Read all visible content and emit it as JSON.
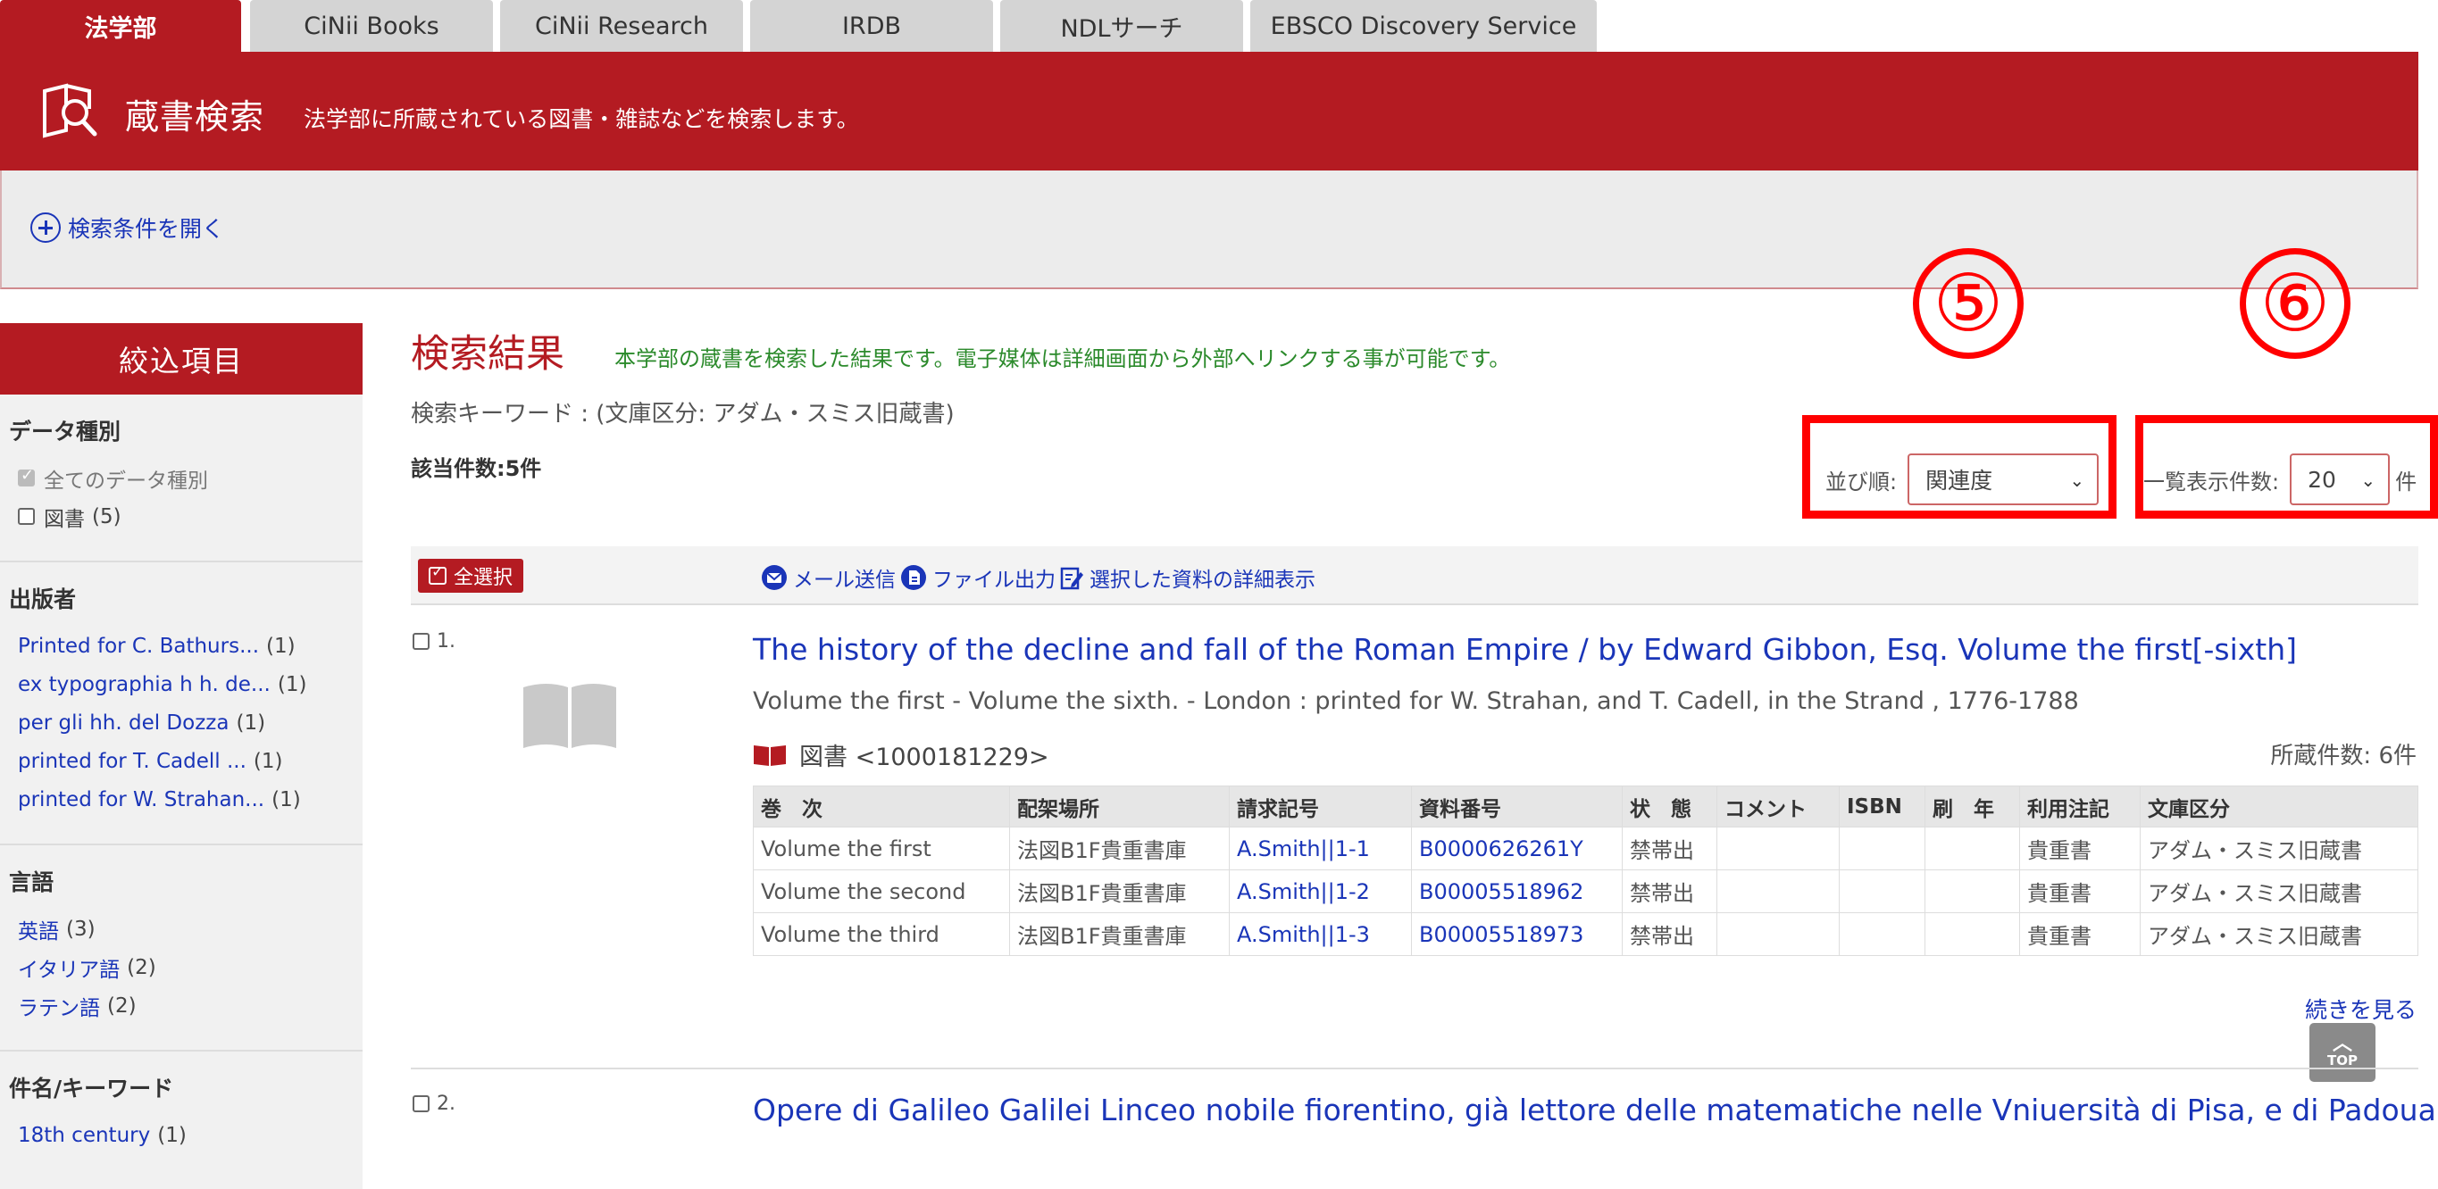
{
  "tabs": [
    {
      "label": "法学部"
    },
    {
      "label": "CiNii Books"
    },
    {
      "label": "CiNii Research"
    },
    {
      "label": "IRDB"
    },
    {
      "label": "NDLサーチ"
    },
    {
      "label": "EBSCO Discovery Service"
    }
  ],
  "header": {
    "title": "蔵書検索",
    "description": "法学部に所蔵されている図書・雑誌などを検索します。"
  },
  "conditions": {
    "open_label": "検索条件を開く"
  },
  "sidebar": {
    "heading": "絞込項目",
    "sections": [
      {
        "title": "データ種別",
        "items": [
          {
            "label": "全てのデータ種別",
            "count": ""
          },
          {
            "label": "図書",
            "count": "(5)"
          }
        ]
      },
      {
        "title": "出版者",
        "items": [
          {
            "label": "Printed for C. Bathurs...",
            "count": "(1)"
          },
          {
            "label": "ex typographia h h. de...",
            "count": "(1)"
          },
          {
            "label": "per gli hh. del Dozza",
            "count": "(1)"
          },
          {
            "label": "printed for T. Cadell ...",
            "count": "(1)"
          },
          {
            "label": "printed for W. Strahan...",
            "count": "(1)"
          }
        ]
      },
      {
        "title": "言語",
        "items": [
          {
            "label": "英語",
            "count": "(3)"
          },
          {
            "label": "イタリア語",
            "count": "(2)"
          },
          {
            "label": "ラテン語",
            "count": "(2)"
          }
        ]
      },
      {
        "title": "件名/キーワード",
        "items": [
          {
            "label": "18th century",
            "count": "(1)"
          }
        ]
      }
    ]
  },
  "results": {
    "title": "検索結果",
    "note": "本学部の蔵書を検索した結果です。電子媒体は詳細画面から外部へリンクする事が可能です。",
    "keyword": "検索キーワード : (文庫区分: アダム・スミス旧蔵書)",
    "count": "該当件数:5件",
    "sort_label": "並び順:",
    "sort_value": "関連度",
    "per_page_label": "一覧表示件数:",
    "per_page_value": "20",
    "per_page_unit": "件"
  },
  "annotations": {
    "sort_marker": "⑤",
    "per_page_marker": "⑥",
    "color": "#ff0000"
  },
  "toolbar": {
    "select_all": "全選択",
    "mail": "メール送信",
    "file_export": "ファイル出力",
    "show_selected": "選択した資料の詳細表示"
  },
  "items": [
    {
      "number": "1.",
      "title": "The history of the decline and fall of the Roman Empire / by Edward Gibbon, Esq. Volume the first[-sixth]",
      "subtitle": "Volume the first - Volume the sixth. - London : printed for W. Strahan, and T. Cadell, in the Strand , 1776-1788",
      "type": "図書 <1000181229>",
      "holdings": "所蔵件数: 6件",
      "table_headers": [
        "巻　次",
        "配架場所",
        "請求記号",
        "資料番号",
        "状　態",
        "コメント",
        "ISBN",
        "刷　年",
        "利用注記",
        "文庫区分"
      ],
      "rows": [
        [
          "Volume the first",
          "法図B1F貴重書庫",
          "A.Smith||1-1",
          "B0000626261Y",
          "禁帯出",
          "",
          "",
          "",
          "貴重書",
          "アダム・スミス旧蔵書"
        ],
        [
          "Volume the second",
          "法図B1F貴重書庫",
          "A.Smith||1-2",
          "B00005518962",
          "禁帯出",
          "",
          "",
          "",
          "貴重書",
          "アダム・スミス旧蔵書"
        ],
        [
          "Volume the third",
          "法図B1F貴重書庫",
          "A.Smith||1-3",
          "B00005518973",
          "禁帯出",
          "",
          "",
          "",
          "貴重書",
          "アダム・スミス旧蔵書"
        ]
      ],
      "more": "続きを見る"
    },
    {
      "number": "2.",
      "title": "Opere di Galileo Galilei Linceo nobile fiorentino, già lettore delle matematiche nelle Vniuersità di Pisa, e di Padoua, di"
    }
  ],
  "top_button": "TOP",
  "colors": {
    "brand": "#b41b22",
    "link": "#1a35b8",
    "note_green": "#2b8a2b"
  }
}
